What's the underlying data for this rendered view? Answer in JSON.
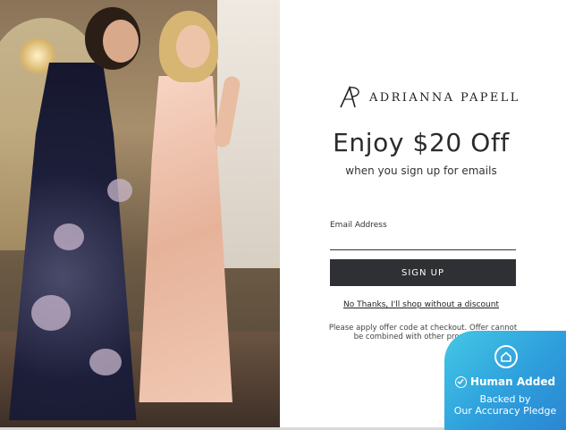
{
  "brand": {
    "name": "ADRIANNA PAPELL",
    "logo_icon": "ap-monogram-icon"
  },
  "offer": {
    "headline": "Enjoy $20 Off",
    "subhead": "when you sign up for emails"
  },
  "form": {
    "email_label": "Email Address",
    "email_value": "",
    "email_placeholder": "",
    "submit_label": "SIGN UP"
  },
  "decline_link": "No Thanks, I'll shop without a discount",
  "disclaimer": "Please apply offer code at checkout. Offer cannot be combined with other promotions.",
  "badge": {
    "title": "Human Added",
    "line1": "Backed by",
    "line2": "Our Accuracy Pledge",
    "icon_top": "house-icon",
    "icon_check": "check-circle-icon",
    "gradient_start": "#44c8e6",
    "gradient_end": "#2b86d2"
  },
  "colors": {
    "button_bg": "#2f3033",
    "text_dark": "#2b2b2b"
  },
  "photo": {
    "subject": "two-women-in-gowns-photo"
  }
}
